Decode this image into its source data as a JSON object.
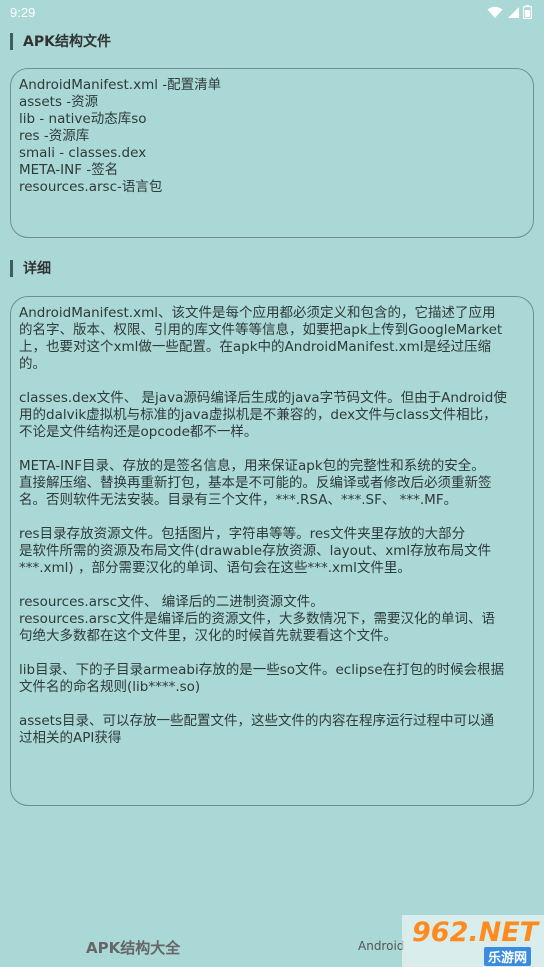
{
  "status": {
    "time": "9:29"
  },
  "sections": {
    "structure_title": "APK结构文件",
    "detail_title": "详细"
  },
  "structure_lines": [
    "AndroidManifest.xml -配置清单",
    "assets -资源",
    "lib - native动态库so",
    "res -资源库",
    "smali - classes.dex",
    "META-INF -签名",
    "resources.arsc-语言包"
  ],
  "detail_paragraphs": [
    [
      "AndroidManifest.xml、该文件是每个应用都必须定义和包含的，它描述了应用",
      "的名字、版本、权限、引用的库文件等等信息，如要把apk上传到GoogleMarket",
      "上，也要对这个xml做一些配置。在apk中的AndroidManifest.xml是经过压缩",
      "的。"
    ],
    [
      "classes.dex文件、 是java源码编译后生成的java字节码文件。但由于Android使",
      "用的dalvik虚拟机与标准的java虚拟机是不兼容的，dex文件与class文件相比，",
      "不论是文件结构还是opcode都不一样。"
    ],
    [
      "META-INF目录、存放的是签名信息，用来保证apk包的完整性和系统的安全。",
      "直接解压缩、替换再重新打包，基本是不可能的。反编译或者修改后必须重新签",
      "名。否则软件无法安装。目录有三个文件，***.RSA、***.SF、 ***.MF。"
    ],
    [
      "res目录存放资源文件。包括图片，字符串等等。res文件夹里存放的大部分",
      "是软件所需的资源及布局文件(drawable存放资源、layout、xml存放布局文件",
      "***.xml) ，部分需要汉化的单词、语句会在这些***.xml文件里。"
    ],
    [
      "resources.arsc文件、 编译后的二进制资源文件。",
      "resources.arsc文件是编译后的资源文件，大多数情况下，需要汉化的单词、语",
      "句绝大多数都在这个文件里，汉化的时候首先就要看这个文件。"
    ],
    [
      "lib目录、下的子目录armeabi存放的是一些so文件。eclipse在打包的时候会根据",
      "文件名的命名规则(lib****.so)"
    ],
    [
      "assets目录、可以存放一些配置文件，这些文件的内容在程序运行过程中可以通",
      "过相关的API获得"
    ]
  ],
  "bottom": {
    "tab_left": "APK结构大全",
    "tab_right": "Android"
  },
  "watermark": {
    "top": "962.NET",
    "bottom": "乐游网"
  }
}
